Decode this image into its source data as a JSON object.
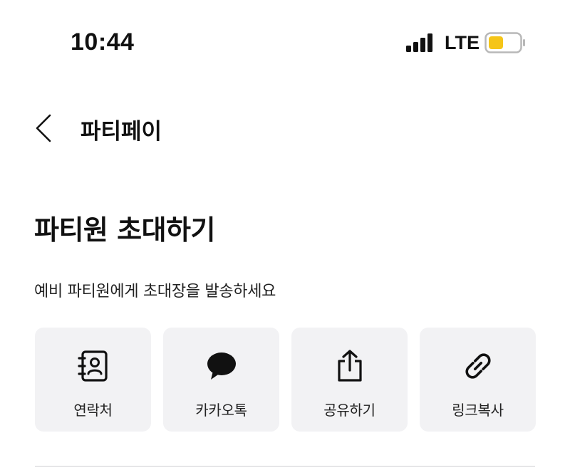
{
  "status_bar": {
    "time": "10:44",
    "network": "LTE",
    "signal_icon": "signal-bars-icon",
    "battery_icon": "battery-low-icon",
    "battery_color": "#f5c518"
  },
  "nav": {
    "back_icon": "chevron-left-icon",
    "title": "파티페이"
  },
  "main": {
    "title": "파티원 초대하기",
    "subtitle": "예비 파티원에게 초대장을 발송하세요",
    "share_options": [
      {
        "label": "연락처",
        "icon": "contact-book-icon"
      },
      {
        "label": "카카오톡",
        "icon": "speech-bubble-icon"
      },
      {
        "label": "공유하기",
        "icon": "share-icon"
      },
      {
        "label": "링크복사",
        "icon": "link-icon"
      }
    ]
  },
  "colors": {
    "tile_background": "#f2f2f4",
    "text_primary": "#111111",
    "divider": "#e6e6e8"
  }
}
